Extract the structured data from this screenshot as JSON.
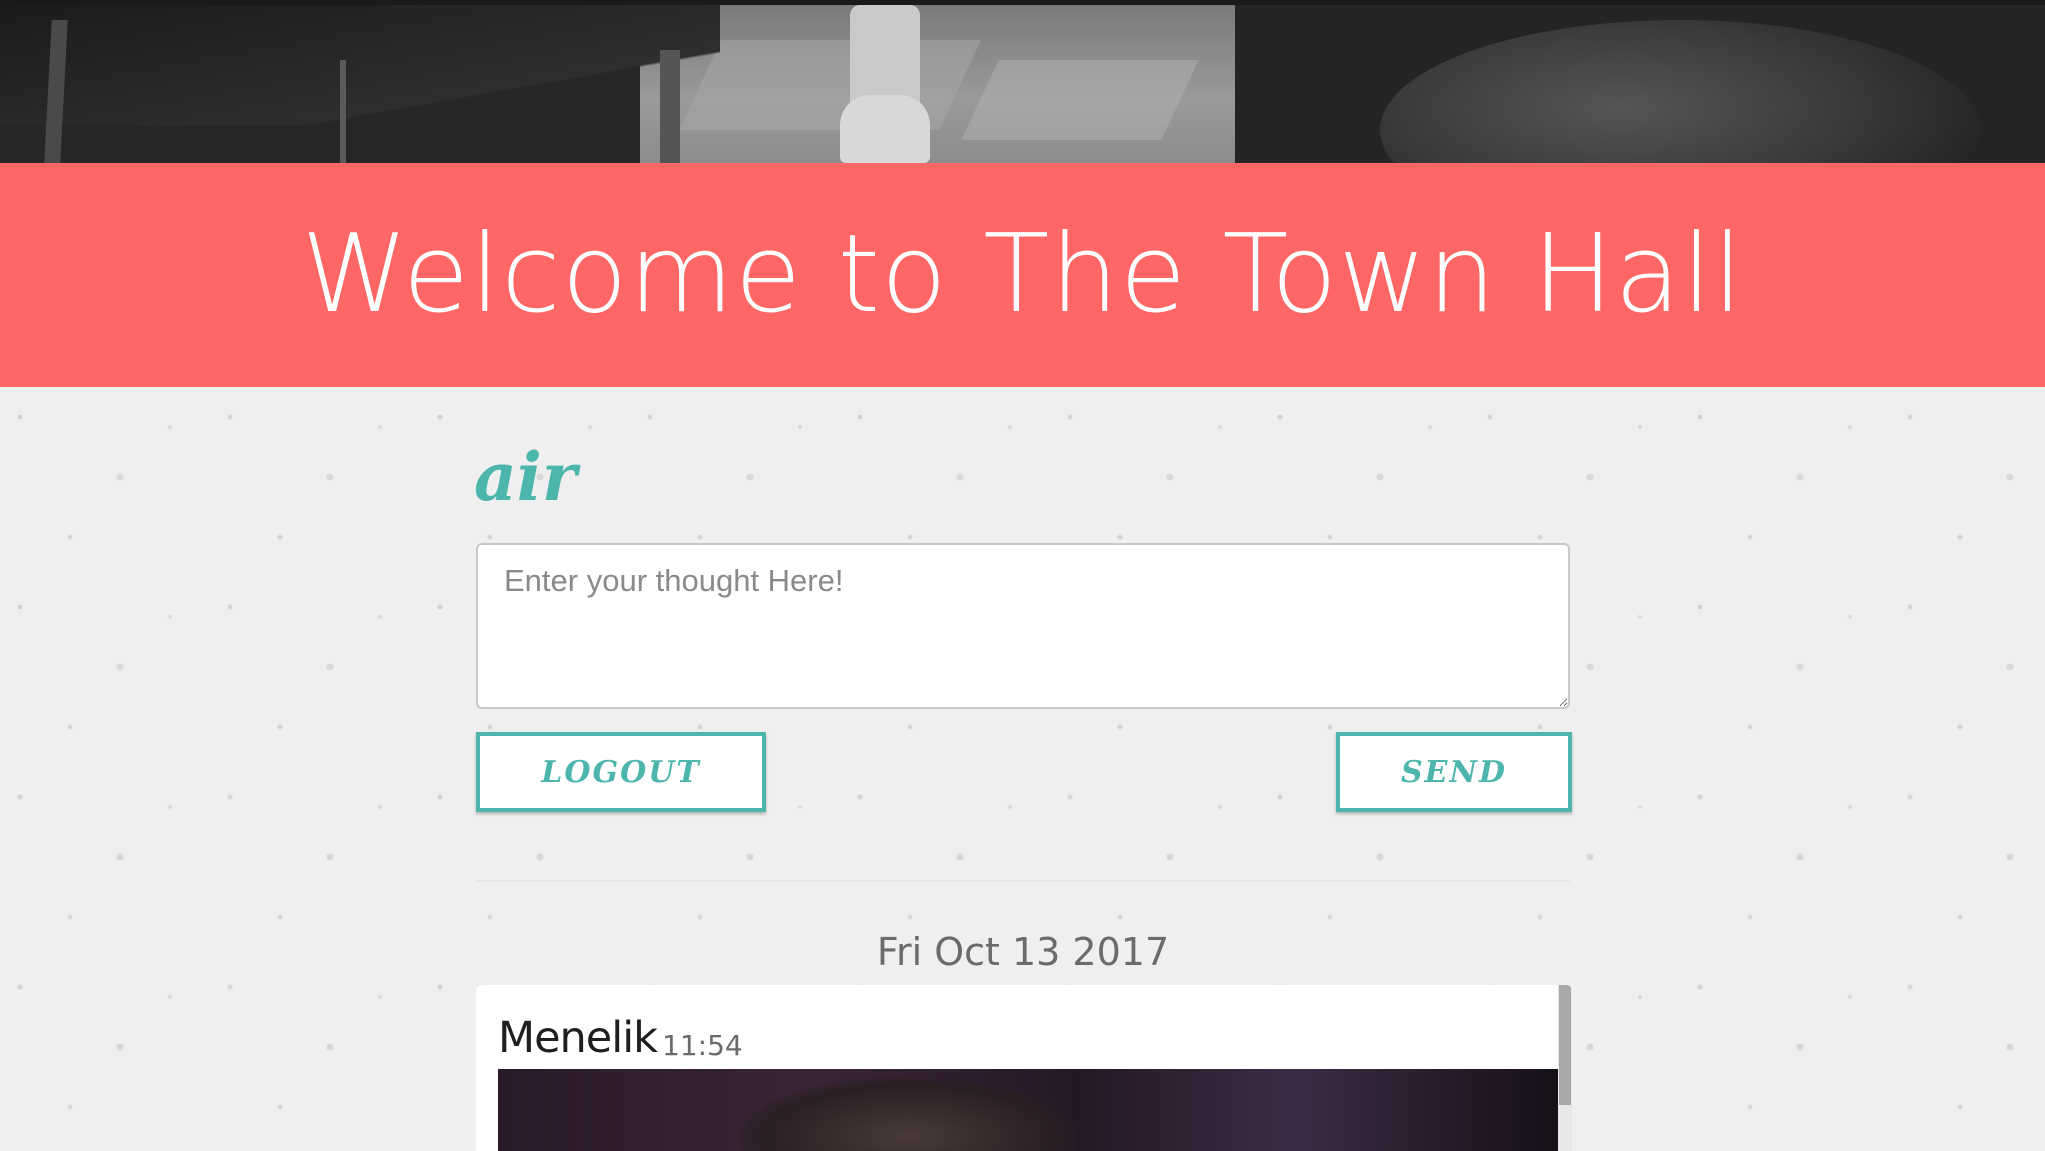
{
  "banner": {
    "title": "Welcome to The Town Hall"
  },
  "composer": {
    "username": "air",
    "placeholder": "Enter your thought Here!",
    "value": ""
  },
  "actions": {
    "logout_label": "LOGOUT",
    "send_label": "SEND"
  },
  "feed": {
    "date_heading": "Fri Oct 13 2017",
    "messages": [
      {
        "author": "Menelik",
        "time": "11:54",
        "has_image": true
      }
    ]
  },
  "colors": {
    "banner": "#ff6666",
    "accent": "#4db6ac",
    "background": "#efefef"
  }
}
